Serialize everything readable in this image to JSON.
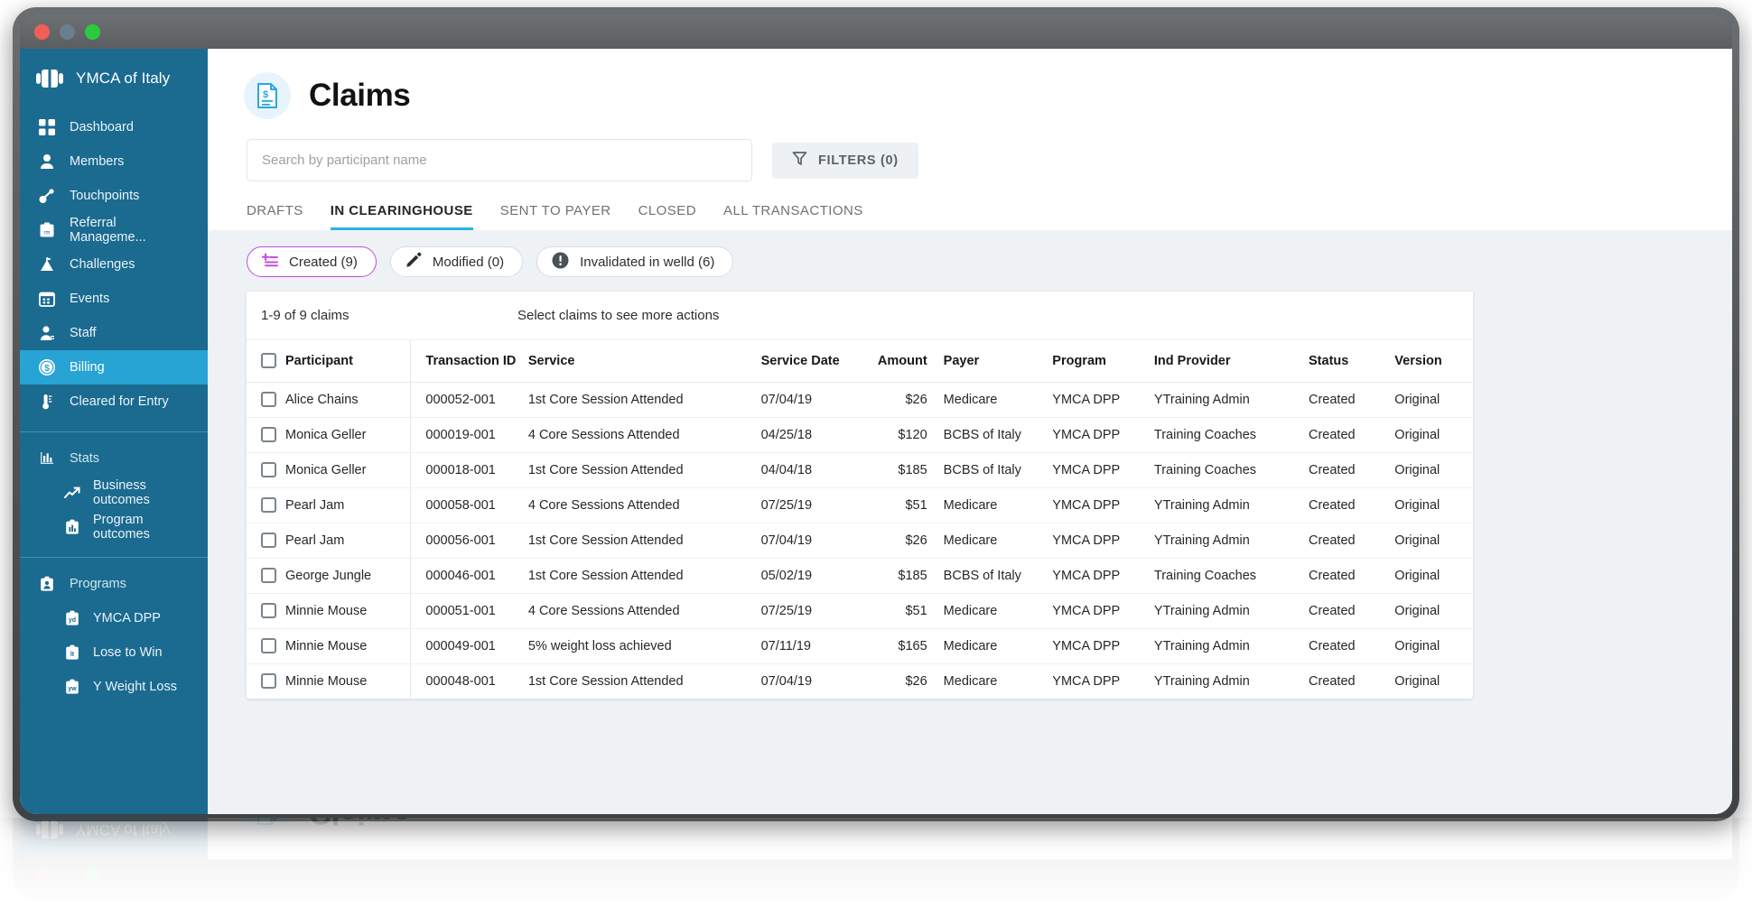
{
  "window": {
    "traffic_lights": [
      "close",
      "minimize",
      "zoom"
    ]
  },
  "sidebar": {
    "brand": {
      "label": "YMCA of Italy",
      "icon": "ymca-logo-icon"
    },
    "items": [
      {
        "label": "Dashboard",
        "icon": "grid-icon",
        "active": false,
        "sub": false
      },
      {
        "label": "Members",
        "icon": "person-icon",
        "active": false,
        "sub": false
      },
      {
        "label": "Touchpoints",
        "icon": "node-link-icon",
        "active": false,
        "sub": false
      },
      {
        "label": "Referral Manageme...",
        "icon": "clipboard-rm-icon",
        "active": false,
        "sub": false
      },
      {
        "label": "Challenges",
        "icon": "mountain-icon",
        "active": false,
        "sub": false
      },
      {
        "label": "Events",
        "icon": "calendar-icon",
        "active": false,
        "sub": false
      },
      {
        "label": "Staff",
        "icon": "badge-person-icon",
        "active": false,
        "sub": false
      },
      {
        "label": "Billing",
        "icon": "dollar-coin-icon",
        "active": true,
        "sub": false
      },
      {
        "label": "Cleared for Entry",
        "icon": "thermometer-icon",
        "active": false,
        "sub": false
      }
    ],
    "stats_group": [
      {
        "label": "Stats",
        "icon": "bar-chart-icon",
        "sub": false
      },
      {
        "label": "Business outcomes",
        "icon": "trend-up-icon",
        "sub": true
      },
      {
        "label": "Program outcomes",
        "icon": "chart-board-icon",
        "sub": true
      }
    ],
    "programs_group": [
      {
        "label": "Programs",
        "icon": "clipboard-person-icon",
        "sub": false
      },
      {
        "label": "YMCA DPP",
        "icon": "clipboard-yd-icon",
        "sub": true
      },
      {
        "label": "Lose to Win",
        "icon": "clipboard-lt-icon",
        "sub": true
      },
      {
        "label": "Y Weight Loss",
        "icon": "clipboard-yw-icon",
        "sub": true
      }
    ]
  },
  "header": {
    "title": "Claims",
    "title_icon": "claim-document-dollar-icon"
  },
  "search": {
    "placeholder": "Search by participant name",
    "value": ""
  },
  "filters_button": {
    "label": "FILTERS (0)",
    "icon": "funnel-icon"
  },
  "tabs": [
    {
      "label": "DRAFTS",
      "active": false
    },
    {
      "label": "IN CLEARINGHOUSE",
      "active": true
    },
    {
      "label": "SENT TO PAYER",
      "active": false
    },
    {
      "label": "CLOSED",
      "active": false
    },
    {
      "label": "ALL TRANSACTIONS",
      "active": false
    }
  ],
  "chips": [
    {
      "label": "Created (9)",
      "icon": "add-lines-icon",
      "selected": true
    },
    {
      "label": "Modified (0)",
      "icon": "pencil-icon",
      "selected": false
    },
    {
      "label": "Invalidated in welld (6)",
      "icon": "exclamation-circle-icon",
      "selected": false
    }
  ],
  "table": {
    "count_label": "1-9 of 9 claims",
    "hint_label": "Select claims to see more actions",
    "columns": [
      "Participant",
      "Transaction ID",
      "Service",
      "Service Date",
      "Amount",
      "Payer",
      "Program",
      "Ind Provider",
      "Status",
      "Version"
    ],
    "rows": [
      {
        "participant": "Alice Chains",
        "txn": "000052-001",
        "service": "1st Core Session Attended",
        "date": "07/04/19",
        "amount": "$26",
        "payer": "Medicare",
        "program": "YMCA DPP",
        "provider": "YTraining Admin",
        "status": "Created",
        "version": "Original"
      },
      {
        "participant": "Monica Geller",
        "txn": "000019-001",
        "service": "4 Core Sessions Attended",
        "date": "04/25/18",
        "amount": "$120",
        "payer": "BCBS of Italy",
        "program": "YMCA DPP",
        "provider": "Training Coaches",
        "status": "Created",
        "version": "Original"
      },
      {
        "participant": "Monica Geller",
        "txn": "000018-001",
        "service": "1st Core Session Attended",
        "date": "04/04/18",
        "amount": "$185",
        "payer": "BCBS of Italy",
        "program": "YMCA DPP",
        "provider": "Training Coaches",
        "status": "Created",
        "version": "Original"
      },
      {
        "participant": "Pearl Jam",
        "txn": "000058-001",
        "service": "4 Core Sessions Attended",
        "date": "07/25/19",
        "amount": "$51",
        "payer": "Medicare",
        "program": "YMCA DPP",
        "provider": "YTraining Admin",
        "status": "Created",
        "version": "Original"
      },
      {
        "participant": "Pearl Jam",
        "txn": "000056-001",
        "service": "1st Core Session Attended",
        "date": "07/04/19",
        "amount": "$26",
        "payer": "Medicare",
        "program": "YMCA DPP",
        "provider": "YTraining Admin",
        "status": "Created",
        "version": "Original"
      },
      {
        "participant": "George Jungle",
        "txn": "000046-001",
        "service": "1st Core Session Attended",
        "date": "05/02/19",
        "amount": "$185",
        "payer": "BCBS of Italy",
        "program": "YMCA DPP",
        "provider": "Training Coaches",
        "status": "Created",
        "version": "Original"
      },
      {
        "participant": "Minnie Mouse",
        "txn": "000051-001",
        "service": "4 Core Sessions Attended",
        "date": "07/25/19",
        "amount": "$51",
        "payer": "Medicare",
        "program": "YMCA DPP",
        "provider": "YTraining Admin",
        "status": "Created",
        "version": "Original"
      },
      {
        "participant": "Minnie Mouse",
        "txn": "000049-001",
        "service": "5% weight loss achieved",
        "date": "07/11/19",
        "amount": "$165",
        "payer": "Medicare",
        "program": "YMCA DPP",
        "provider": "YTraining Admin",
        "status": "Created",
        "version": "Original"
      },
      {
        "participant": "Minnie Mouse",
        "txn": "000048-001",
        "service": "1st Core Session Attended",
        "date": "07/04/19",
        "amount": "$26",
        "payer": "Medicare",
        "program": "YMCA DPP",
        "provider": "YTraining Admin",
        "status": "Created",
        "version": "Original"
      }
    ]
  },
  "colors": {
    "sidebar_bg": "#1b6a90",
    "sidebar_active": "#27a3d4",
    "accent_tab": "#27b5e0",
    "chip_selected_border": "#c44ce0",
    "page_bg": "#eef2f5",
    "title_badge_bg": "#e6f5fd"
  }
}
